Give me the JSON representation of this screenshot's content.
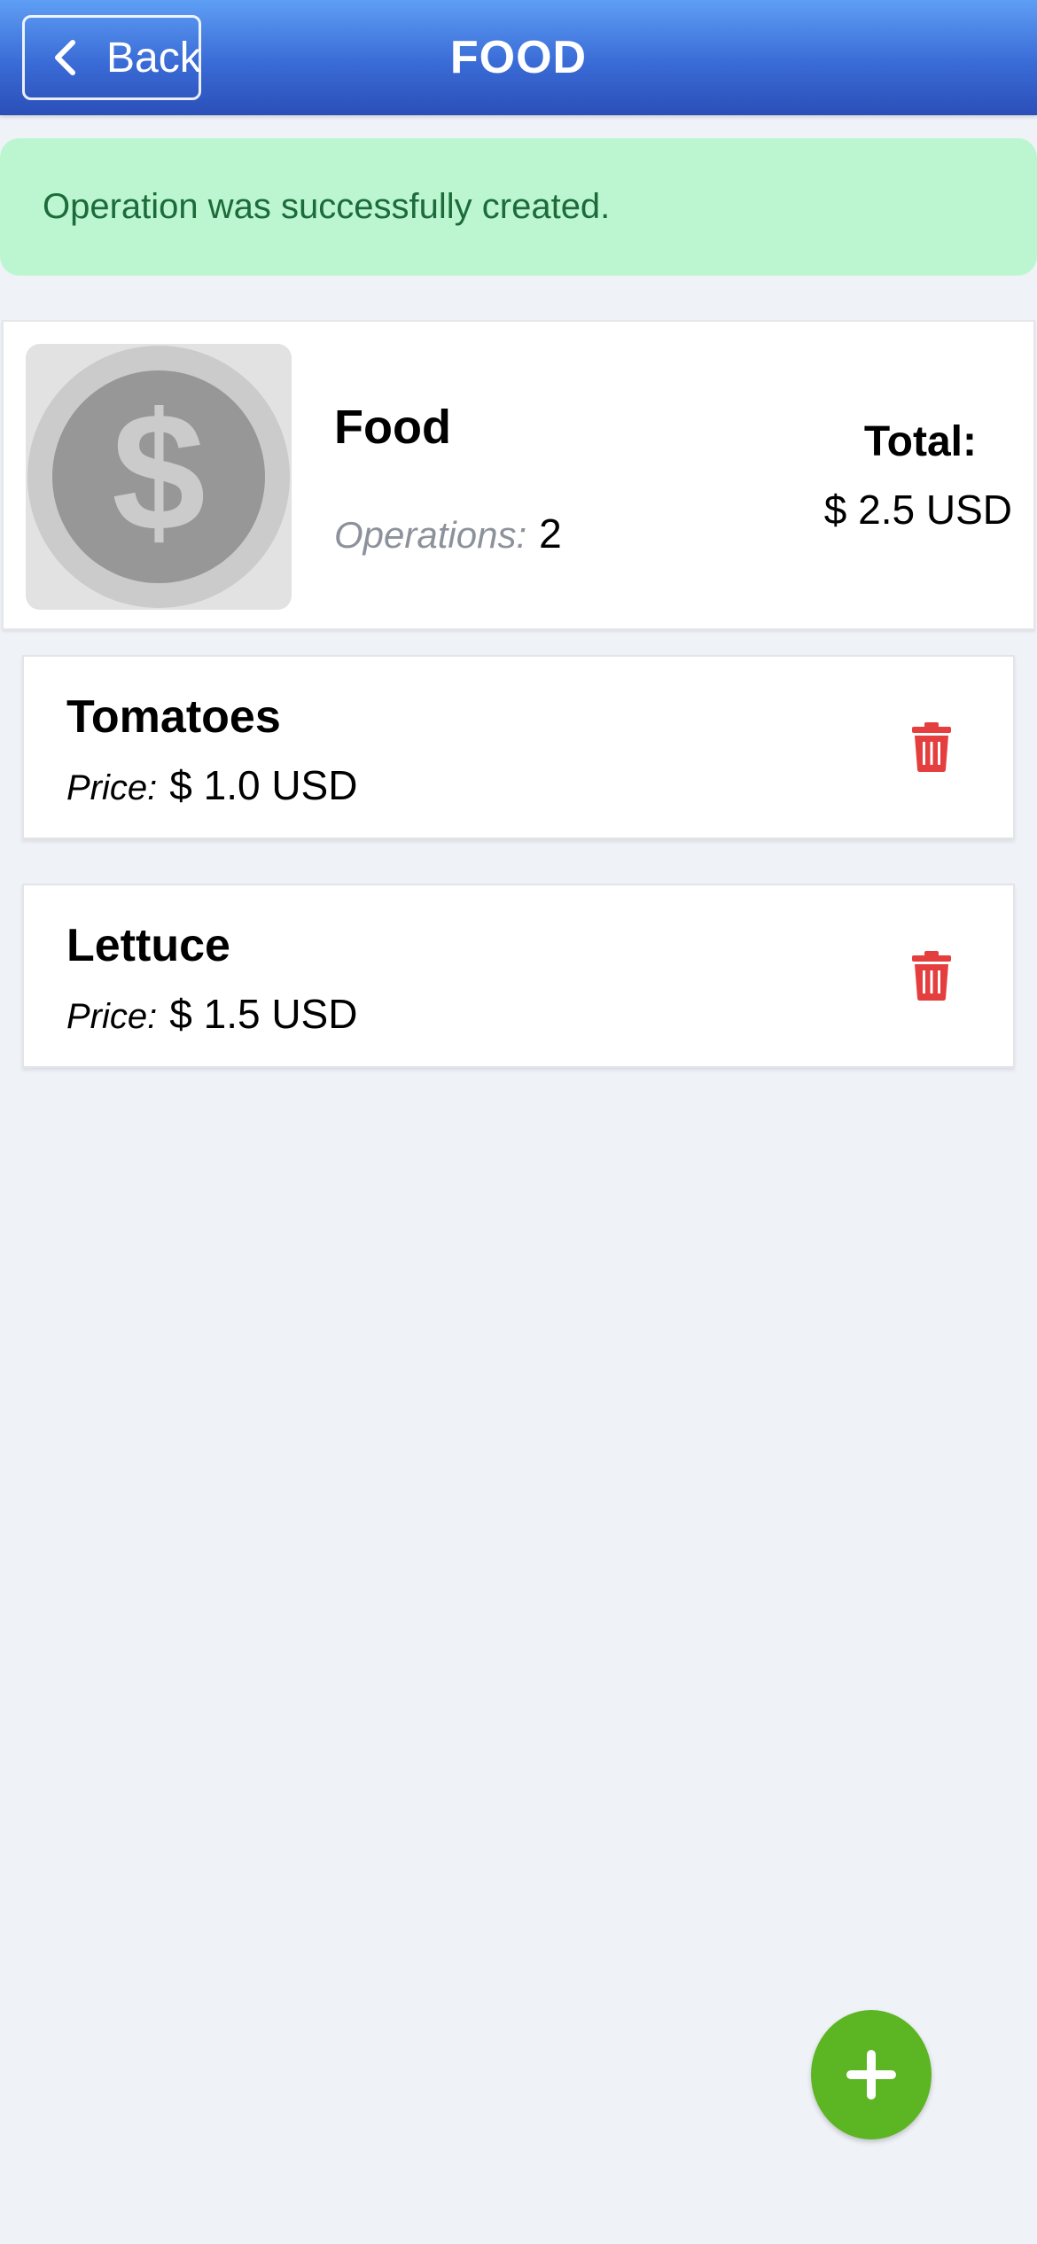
{
  "header": {
    "back_label": "Back",
    "title": "FOOD"
  },
  "alert": {
    "message": "Operation was successfully created."
  },
  "category": {
    "name": "Food",
    "icon": "dollar-coin-icon",
    "operations_label": "Operations:",
    "operations_count": "2",
    "total_label": "Total:",
    "total_value": "$ 2.5 USD"
  },
  "operations": [
    {
      "name": "Tomatoes",
      "price_label": "Price:",
      "price_value": "$ 1.0 USD"
    },
    {
      "name": "Lettuce",
      "price_label": "Price:",
      "price_value": "$ 1.5 USD"
    }
  ],
  "colors": {
    "header": "#3a6bd6",
    "alert_bg": "#bbf6d0",
    "alert_text": "#1c6b3a",
    "delete": "#e53e3e",
    "fab": "#5cb523",
    "background": "#eff2f7"
  },
  "fab": {
    "icon": "plus-icon"
  }
}
